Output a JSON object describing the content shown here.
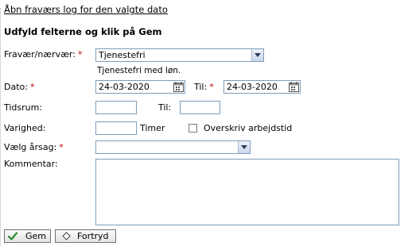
{
  "header": {
    "log_link": "Åbn fraværs log for den valgte dato",
    "instruction": "Udfyld felterne og klik på Gem"
  },
  "form": {
    "absence": {
      "label": "Fravær/nærvær:",
      "required_mark": "*",
      "selected": "Tjenestefri",
      "description": "Tjenestefri med løn."
    },
    "date": {
      "label": "Dato:",
      "required_mark": "*",
      "value": "24-03-2020",
      "to_label": "Til:",
      "to_required_mark": "*",
      "to_value": "24-03-2020"
    },
    "timespan": {
      "label": "Tidsrum:",
      "from_value": "",
      "to_label": "Til:",
      "to_value": ""
    },
    "duration": {
      "label": "Varighed:",
      "value": "",
      "unit": "Timer",
      "override_label": "Overskriv arbejdstid",
      "override_checked": false
    },
    "reason": {
      "label": "Vælg årsag:",
      "required_mark": "*",
      "selected": ""
    },
    "comment": {
      "label": "Kommentar:",
      "value": ""
    }
  },
  "buttons": {
    "save": "Gem",
    "cancel": "Fortryd"
  },
  "colors": {
    "required": "#c00000",
    "field_border": "#7f9db9",
    "save_check": "#2e8b2e"
  },
  "icons": {
    "calendar": "calendar-icon",
    "dropdown": "chevron-down-icon",
    "save": "check-icon",
    "cancel": "diamond-icon"
  }
}
